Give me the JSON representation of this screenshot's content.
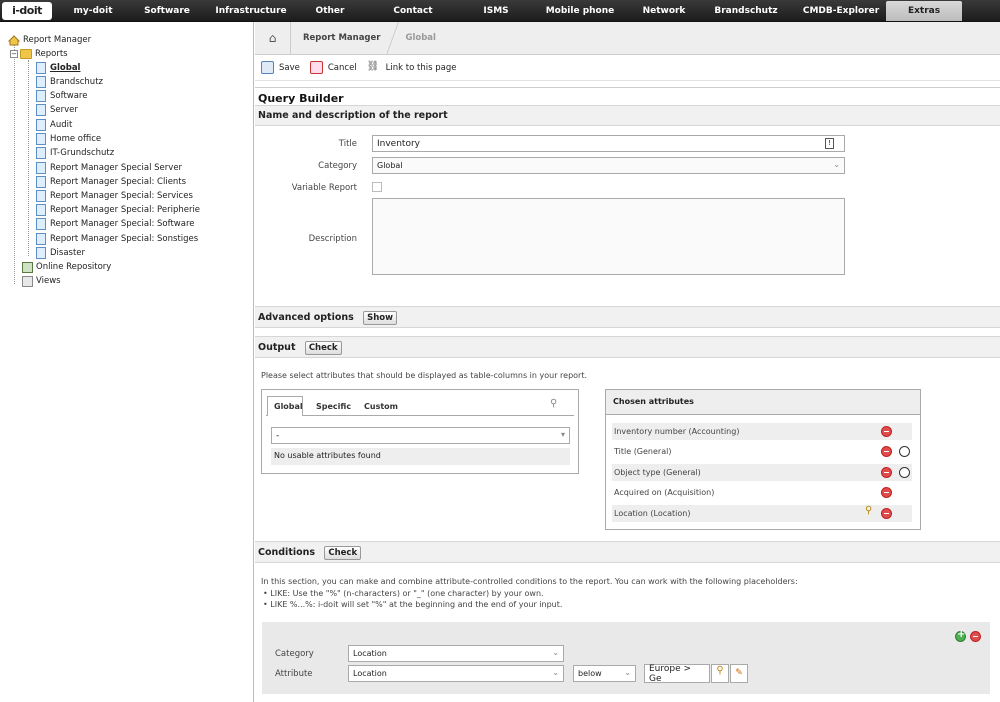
{
  "nav": {
    "logo": "i-doit",
    "items": [
      "my-doit",
      "Software",
      "Infrastructure",
      "Other",
      "Contact",
      "ISMS",
      "Mobile phone",
      "Network",
      "Brandschutz",
      "CMDB-Explorer",
      "Extras"
    ],
    "active": "Extras"
  },
  "tree": {
    "root": "Report Manager",
    "reports_label": "Reports",
    "reports": [
      "Global",
      "Brandschutz",
      "Software",
      "Server",
      "Audit",
      "Home office",
      "IT-Grundschutz",
      "Report Manager Special Server",
      "Report Manager Special: Clients",
      "Report Manager Special: Services",
      "Report Manager Special: Peripherie",
      "Report Manager Special: Software",
      "Report Manager Special: Sonstiges",
      "Disaster"
    ],
    "selected": "Global",
    "online_repository": "Online Repository",
    "views": "Views"
  },
  "breadcrumb": {
    "item1": "Report Manager",
    "item2": "Global"
  },
  "toolbar": {
    "save": "Save",
    "cancel": "Cancel",
    "link": "Link to this page"
  },
  "page_title": "Query Builder",
  "name_section": {
    "title": "Name and description of the report",
    "title_label": "Title",
    "title_value": "Inventory",
    "category_label": "Category",
    "category_value": "Global",
    "variable_label": "Variable Report",
    "description_label": "Description"
  },
  "advanced": {
    "label": "Advanced options",
    "button": "Show"
  },
  "output": {
    "label": "Output",
    "button": "Check",
    "hint": "Please select attributes that should be displayed as table-columns in your report.",
    "tabs": [
      "Global",
      "Specific",
      "Custom"
    ],
    "select_value": "-",
    "empty_text": "No usable attributes found",
    "chosen_title": "Chosen attributes",
    "chosen": [
      "Inventory number (Accounting)",
      "Title (General)",
      "Object type (General)",
      "Acquired on (Acquisition)",
      "Location (Location)"
    ]
  },
  "conditions": {
    "label": "Conditions",
    "button": "Check",
    "intro": "In this section, you can make and combine attribute-controlled conditions to the report. You can work with the following placeholders:",
    "bullet1": "• LIKE: Use the \"%\" (n-characters) or \"_\" (one character) by your own.",
    "bullet2": "• LIKE %...%: i-doit will set \"%\" at the beginning and the end of your input.",
    "category_label": "Category",
    "category_value": "Location",
    "attribute_label": "Attribute",
    "attribute_value": "Location",
    "operator_value": "below",
    "location_value": "Europe > Ge"
  }
}
